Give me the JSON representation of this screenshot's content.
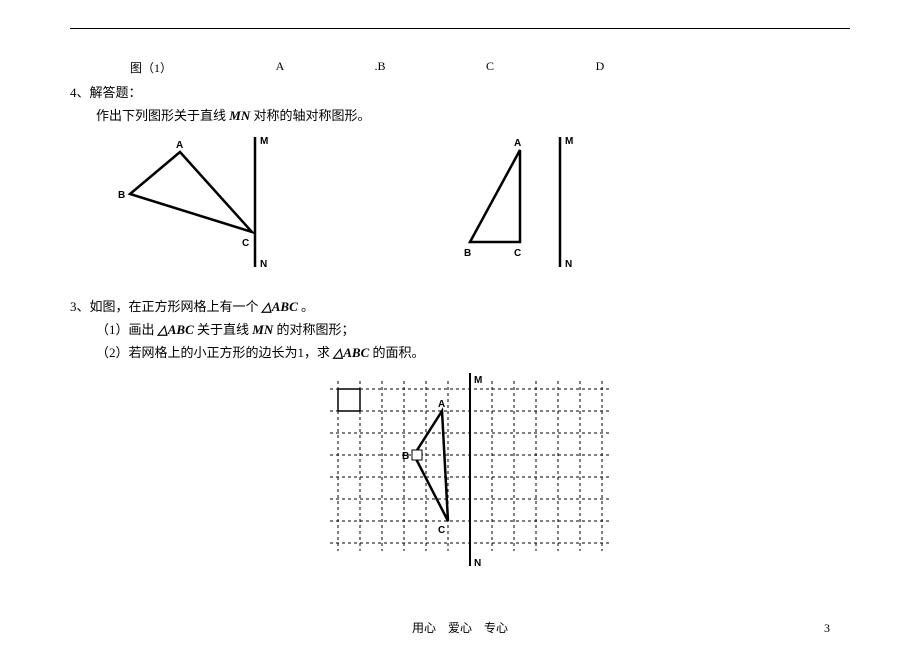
{
  "row": {
    "fig": "图（1）",
    "a": "A",
    "b": ".B",
    "c": "C",
    "d": "D"
  },
  "q4": {
    "title": "4、解答题：",
    "sub_prefix": "作出下列图形关于直线 ",
    "sub_mn": "MN",
    "sub_suffix": " 对称的轴对称图形。"
  },
  "q3": {
    "title_prefix": "3、如图，在正方形网格上有一个 ",
    "title_tri": "△ABC",
    "title_suffix": " 。",
    "sub1_prefix": "（1）画出 ",
    "sub1_tri": "△ABC",
    "sub1_mid": " 关于直线 ",
    "sub1_mn": "MN",
    "sub1_suffix": " 的对称图形；",
    "sub2_prefix": "（2）若网格上的小正方形的边长为1，求 ",
    "sub2_tri": "△ABC",
    "sub2_suffix": " 的面积。"
  },
  "labels": {
    "A": "A",
    "B": "B",
    "C": "C",
    "M": "M",
    "N": "N"
  },
  "footer": {
    "motto": "用心　爱心　专心",
    "page": "3"
  }
}
